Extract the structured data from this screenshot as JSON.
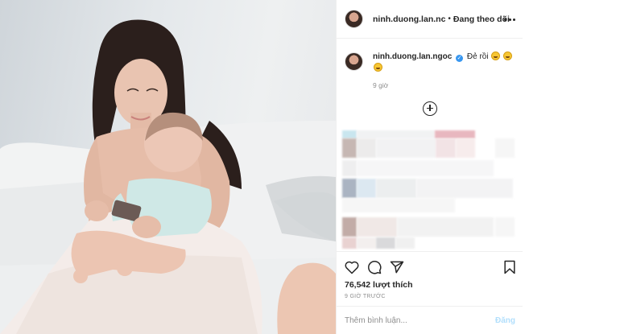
{
  "post": {
    "author": "ninh.duong.lan.nc",
    "separator": "•",
    "follow_status": "Đang theo dõi",
    "more_icon": "more-horizontal-icon"
  },
  "caption": {
    "username": "ninh.duong.lan.ngoc",
    "verified_icon": "verified-badge-icon",
    "text": "Đẻ rồi",
    "emoji": "rolling-on-floor-laughing-emoji",
    "time": "9 giờ"
  },
  "more_comments_icon": "plus-circle-icon",
  "actions": {
    "like_icon": "heart-icon",
    "comment_icon": "comment-icon",
    "share_icon": "paper-plane-icon",
    "save_icon": "bookmark-icon"
  },
  "likes": "76,542 lượt thích",
  "posted_ago": "9 GIỜ TRƯỚC",
  "comment": {
    "placeholder": "Thêm bình luận...",
    "value": "",
    "post_label": "Đăng"
  },
  "colors": {
    "text": "#262626",
    "muted": "#8e8e8e",
    "border": "#efefef",
    "post_disabled": "#b2dffc",
    "verified": "#3897f0"
  }
}
